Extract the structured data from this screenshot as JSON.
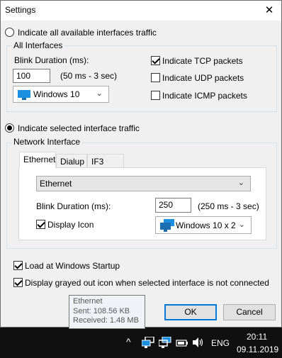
{
  "window": {
    "title": "Settings",
    "close_glyph": "✕"
  },
  "all_interfaces": {
    "radio_label": "Indicate all available interfaces traffic",
    "radio_checked": false,
    "group_label": "All Interfaces",
    "blink_label": "Blink Duration (ms):",
    "blink_value": "100",
    "blink_range": "(50 ms - 3 sec)",
    "icon_combo": "Windows 10",
    "tcp": {
      "label": "Indicate TCP packets",
      "checked": true
    },
    "udp": {
      "label": "Indicate UDP packets",
      "checked": false
    },
    "icmp": {
      "label": "Indicate ICMP packets",
      "checked": false
    }
  },
  "selected_interface": {
    "radio_label": "Indicate selected interface traffic",
    "radio_checked": true,
    "group_label": "Network Interface",
    "tabs": [
      "Ethernet",
      "Dialup",
      "IF3"
    ],
    "active_tab": 0,
    "interface_combo": "Ethernet",
    "blink_label": "Blink Duration (ms):",
    "blink_value": "250",
    "blink_range": "(250 ms - 3 sec)",
    "display_icon": {
      "label": "Display Icon",
      "checked": true
    },
    "icon_combo": "Windows 10 x 2"
  },
  "options": {
    "startup": {
      "label": "Load at Windows Startup",
      "checked": true
    },
    "grayed": {
      "label": "Display grayed out icon when selected interface is not connected",
      "checked": true
    }
  },
  "buttons": {
    "ok": "OK",
    "cancel": "Cancel"
  },
  "tooltip": {
    "title": "Ethernet",
    "sent": "Sent: 108.56 KB",
    "received": "Received: 1.48 MB"
  },
  "taskbar": {
    "chevron": "^",
    "language": "ENG",
    "time": "20:11",
    "date": "09.11.2019",
    "icons": [
      "show-hidden-icons",
      "network-tray-icon-1",
      "network-tray-icon-2",
      "battery-icon",
      "volume-icon"
    ]
  }
}
